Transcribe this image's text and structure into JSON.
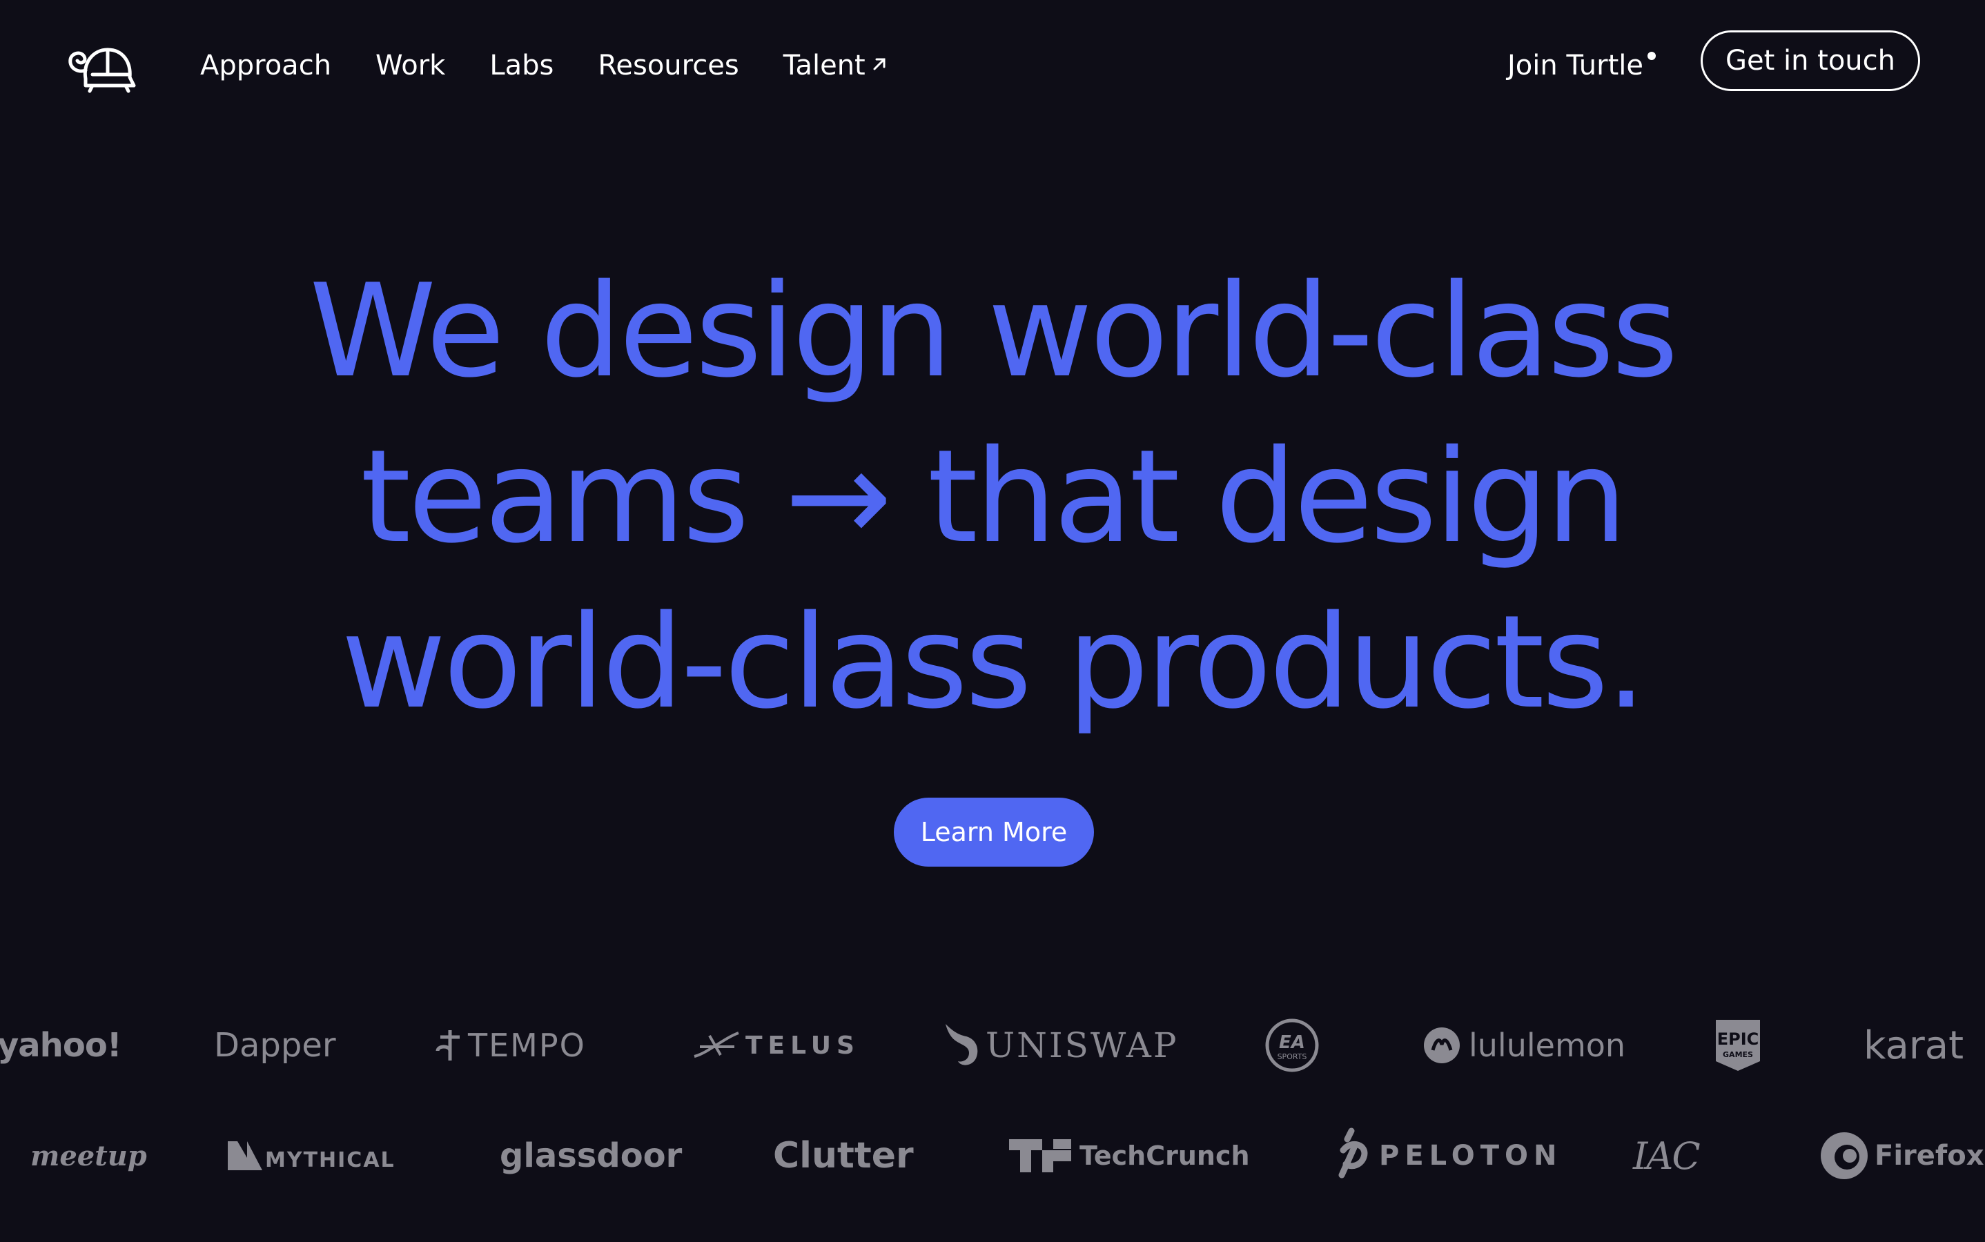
{
  "nav": {
    "links": [
      {
        "label": "Approach"
      },
      {
        "label": "Work"
      },
      {
        "label": "Labs"
      },
      {
        "label": "Resources"
      },
      {
        "label": "Talent",
        "icon": "arrow-up-right-icon"
      }
    ],
    "join_label": "Join Turtle",
    "cta_label": "Get in touch"
  },
  "hero": {
    "line1": "We design world-class",
    "line2": "teams → that design",
    "line3": "world-class products.",
    "button_label": "Learn More"
  },
  "clients": {
    "row1": [
      "yahoo!",
      "Dapper",
      "TEMPO",
      "TELUS",
      "UNISWAP",
      "EA SPORTS",
      "lululemon",
      "EPIC GAMES",
      "karat"
    ],
    "row2": [
      "meetup",
      "MYTHICAL",
      "glassdoor",
      "Clutter",
      "TechCrunch",
      "PELOTON",
      "IAC",
      "Firefox"
    ]
  },
  "colors": {
    "background": "#0e0d17",
    "accent": "#5067f2",
    "text": "#ffffff",
    "logo_gray": "#8b8a92"
  }
}
